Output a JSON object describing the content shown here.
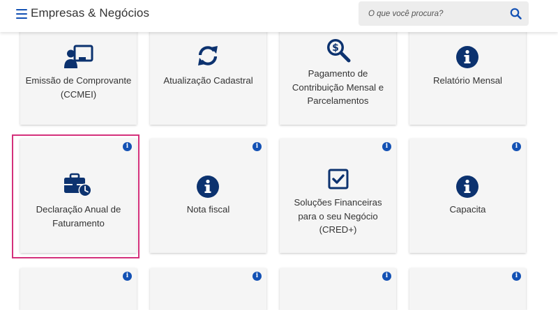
{
  "header": {
    "title": "Empresas & Negócios",
    "menu_icon": "hamburger-menu-icon",
    "search": {
      "placeholder": "O que você procura?",
      "icon": "search-icon"
    }
  },
  "colors": {
    "brand_blue": "#1351b4",
    "icon_navy": "#0c326f",
    "highlight": "#d4307b",
    "card_bg": "#f5f5f5"
  },
  "cards_row1": [
    {
      "label": "Emissão de Comprovante (CCMEI)",
      "icon": "user-presentation-icon"
    },
    {
      "label": "Atualização Cadastral",
      "icon": "sync-icon"
    },
    {
      "label": "Pagamento de Contribuição Mensal e Parcelamentos",
      "icon": "search-dollar-icon"
    },
    {
      "label": "Relatório Mensal",
      "icon": "info-circle-icon"
    }
  ],
  "cards_row2": [
    {
      "label": "Declaração Anual de Faturamento",
      "icon": "briefcase-clock-icon",
      "badge": "i",
      "highlighted": true
    },
    {
      "label": "Nota fiscal",
      "icon": "info-circle-icon",
      "badge": "i"
    },
    {
      "label": "Soluções Financeiras para o seu Negócio (CRED+)",
      "icon": "checkbox-icon",
      "badge": "i"
    },
    {
      "label": "Capacita",
      "icon": "info-circle-icon",
      "badge": "i"
    }
  ],
  "cards_row3": [
    {
      "badge": "i"
    },
    {
      "badge": "i"
    },
    {
      "badge": "i"
    },
    {
      "badge": "i"
    }
  ]
}
